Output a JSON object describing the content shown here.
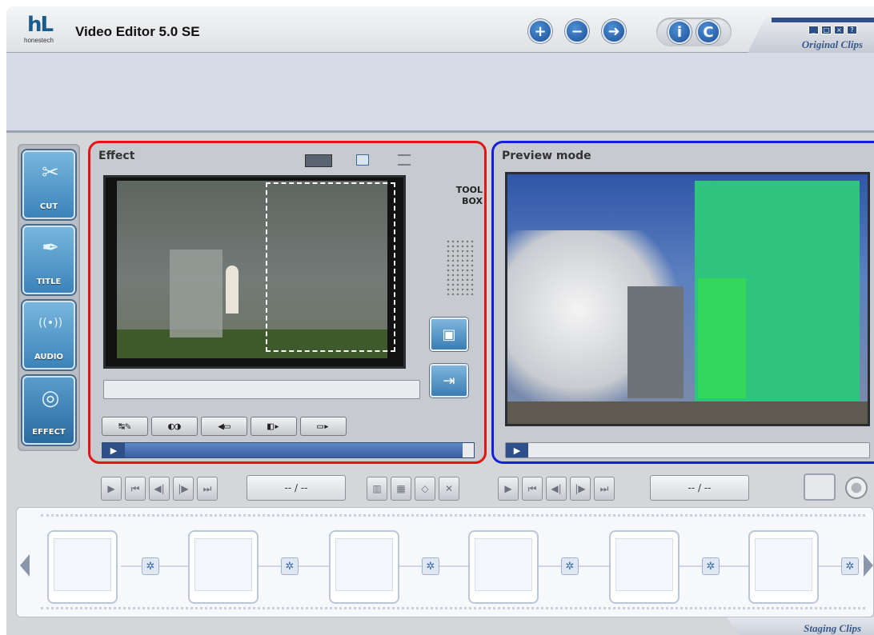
{
  "app": {
    "title": "Video Editor 5.0 SE",
    "brand_mark": "hL",
    "brand_sub": "honestech"
  },
  "header": {
    "buttons": [
      {
        "name": "add-button",
        "glyph": "+"
      },
      {
        "name": "remove-button",
        "glyph": "−"
      },
      {
        "name": "export-button",
        "glyph": "➜"
      }
    ],
    "info_glyph": "i",
    "capture_glyph": "C",
    "original_clips_label": "Original Clips",
    "window_buttons": [
      "_",
      "□",
      "×",
      "?"
    ]
  },
  "tools": [
    {
      "label": "CUT",
      "icon": "scissors-icon",
      "glyph": "✂"
    },
    {
      "label": "TITLE",
      "icon": "pen-icon",
      "glyph": "✒"
    },
    {
      "label": "AUDIO",
      "icon": "sound-wave-icon",
      "glyph": "((•))"
    },
    {
      "label": "EFFECT",
      "icon": "swirl-icon",
      "glyph": "◎"
    }
  ],
  "effect_panel": {
    "title": "Effect",
    "toolbox_line1": "TOOL",
    "toolbox_line2": "BOX",
    "fx_buttons": [
      "↹✎",
      "◐◑",
      "◀▭",
      "◧▸",
      "▭▸"
    ],
    "play": "▶"
  },
  "preview_panel": {
    "title": "Preview  mode",
    "play": "▶"
  },
  "transport": {
    "left_time": "-- / --",
    "right_time": "-- / --"
  },
  "staging": {
    "label": "Staging Clips",
    "slot_count": 6
  },
  "colors": {
    "effect_border": "#e21414",
    "preview_border": "#1420d8",
    "accent": "#2e4f8a"
  }
}
